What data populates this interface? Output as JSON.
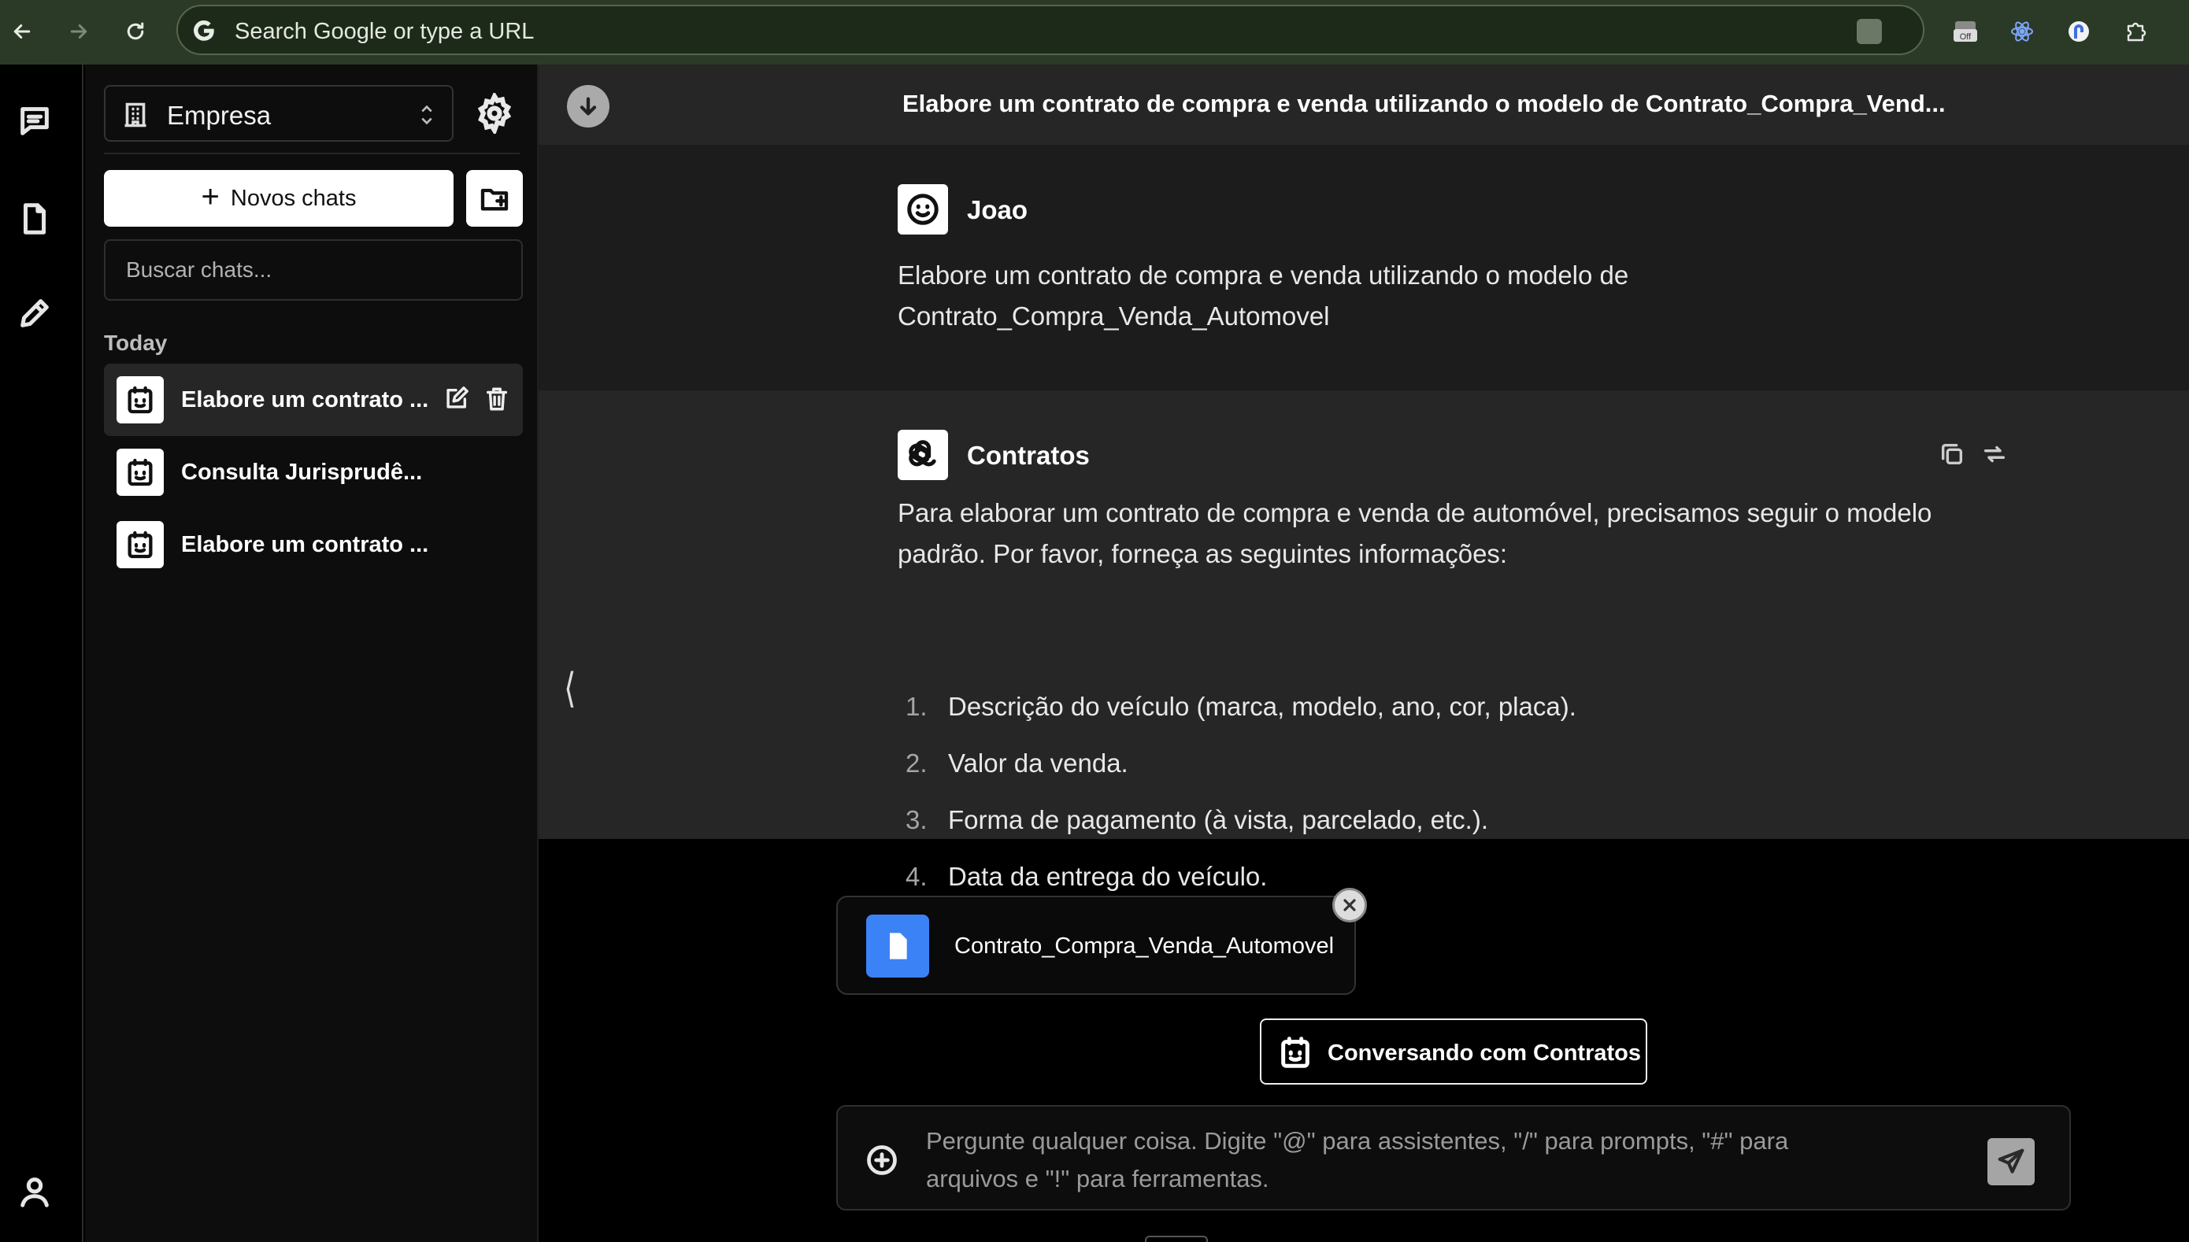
{
  "browser": {
    "url_placeholder": "Search Google or type a URL",
    "extensions": [
      "extension-off-badge-icon",
      "react-devtools-icon",
      "password-manager-icon",
      "puzzle-extensions-icon"
    ],
    "off_badge": "Off"
  },
  "sidebar": {
    "workspace": "Empresa",
    "new_chat_label": "Novos chats",
    "search_placeholder": "Buscar chats...",
    "section_today": "Today",
    "chats": [
      {
        "title": "Elabore um contrato ...",
        "active": true
      },
      {
        "title": "Consulta Jurisprudê...",
        "active": false
      },
      {
        "title": "Elabore um contrato ...",
        "active": false
      }
    ]
  },
  "chat": {
    "title": "Elabore um contrato de compra e venda utilizando o modelo de Contrato_Compra_Vend...",
    "collapse_glyph": "⟨",
    "user_message": {
      "sender": "Joao",
      "text_line1": "Elabore um contrato de compra e venda utilizando o modelo de",
      "text_line2": "Contrato_Compra_Venda_Automovel"
    },
    "bot_message": {
      "sender": "Contratos",
      "intro_line1": "Para elaborar um contrato de compra e venda de automóvel, precisamos seguir o modelo",
      "intro_line2": "padrão. Por favor, forneça as seguintes informações:",
      "items": [
        {
          "num": "1.",
          "text": "Descrição do veículo (marca, modelo, ano, cor, placa)."
        },
        {
          "num": "2.",
          "text": "Valor da venda."
        },
        {
          "num": "3.",
          "text": "Forma de pagamento (à vista, parcelado, etc.)."
        },
        {
          "num": "4.",
          "text": "Data da entrega do veículo."
        }
      ]
    }
  },
  "composer": {
    "attachment_name": "Contrato_Compra_Venda_Automovel",
    "assistant_label": "Conversando com Contratos",
    "placeholder_line1": "Pergunte qualquer coisa. Digite \"@\" para assistentes, \"/\" para prompts, \"#\" para",
    "placeholder_line2": "arquivos e \"!\" para ferramentas."
  },
  "colors": {
    "browser_bar": "#2b3a26",
    "header_bg": "#262626",
    "user_msg_bg": "#1c1c1c",
    "bot_msg_bg": "#262626",
    "file_icon": "#3b82f6"
  }
}
